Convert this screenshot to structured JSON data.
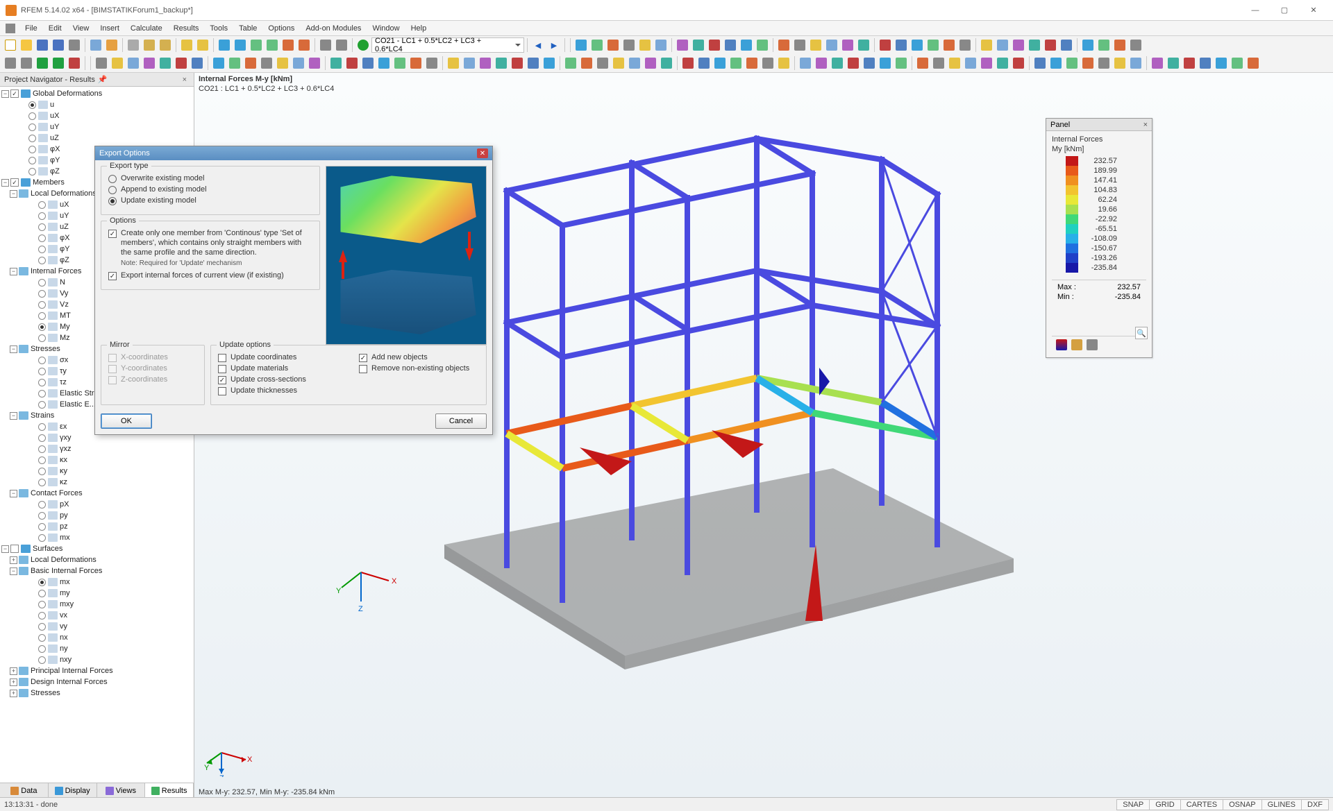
{
  "app": {
    "title": "RFEM 5.14.02 x64 - [BIMSTATIKForum1_backup*]"
  },
  "menu": [
    "File",
    "Edit",
    "View",
    "Insert",
    "Calculate",
    "Results",
    "Tools",
    "Table",
    "Options",
    "Add-on Modules",
    "Window",
    "Help"
  ],
  "combo_dropdown": "CO21 - LC1 + 0.5*LC2 + LC3 + 0.6*LC4",
  "navigator": {
    "title": "Project Navigator - Results",
    "tabs": [
      "Data",
      "Display",
      "Views",
      "Results"
    ],
    "tree": {
      "global_def": {
        "label": "Global Deformations",
        "items": [
          "u",
          "uX",
          "uY",
          "uZ",
          "φX",
          "φY",
          "φZ"
        ]
      },
      "members": {
        "label": "Members",
        "local_def": {
          "label": "Local Deformations",
          "items": [
            "uX",
            "uY",
            "uZ",
            "φX",
            "φY",
            "φZ"
          ]
        },
        "internal_forces": {
          "label": "Internal Forces",
          "items": [
            "N",
            "Vy",
            "Vz",
            "MT",
            "My",
            "Mz"
          ]
        },
        "stresses": {
          "label": "Stresses",
          "items": [
            "σx",
            "τy",
            "τz",
            "Elastic Stress...",
            "Elastic E..."
          ]
        },
        "strains": {
          "label": "Strains",
          "items": [
            "εx",
            "γxy",
            "γxz",
            "κx",
            "κy",
            "κz"
          ]
        },
        "contact": {
          "label": "Contact Forces",
          "items": [
            "pX",
            "py",
            "pz",
            "mx"
          ]
        }
      },
      "surfaces": {
        "label": "Surfaces",
        "local_def": {
          "label": "Local Deformations"
        },
        "basic_if": {
          "label": "Basic Internal Forces",
          "items": [
            "mx",
            "my",
            "mxy",
            "vx",
            "vy",
            "nx",
            "ny",
            "nxy"
          ]
        },
        "principal_if": {
          "label": "Principal Internal Forces"
        },
        "design_if": {
          "label": "Design Internal Forces"
        },
        "stresses2": {
          "label": "Stresses"
        }
      }
    }
  },
  "viewport": {
    "header1": "Internal Forces M-y [kNm]",
    "header2": "CO21 : LC1 + 0.5*LC2 + LC3 + 0.6*LC4",
    "footer": "Max M-y: 232.57, Min M-y: -235.84 kNm"
  },
  "panel": {
    "title": "Panel",
    "sub1": "Internal Forces",
    "sub2": "My  [kNm]",
    "legend": [
      {
        "c": "#c31818",
        "v": "232.57"
      },
      {
        "c": "#e85a1a",
        "v": "189.99"
      },
      {
        "c": "#f09020",
        "v": "147.41"
      },
      {
        "c": "#f2c430",
        "v": "104.83"
      },
      {
        "c": "#e8e838",
        "v": "62.24"
      },
      {
        "c": "#a8e050",
        "v": "19.66"
      },
      {
        "c": "#40d878",
        "v": "-22.92"
      },
      {
        "c": "#20d0c0",
        "v": "-65.51"
      },
      {
        "c": "#28b0e8",
        "v": "-108.09"
      },
      {
        "c": "#2070e0",
        "v": "-150.67"
      },
      {
        "c": "#2040c8",
        "v": "-193.26"
      },
      {
        "c": "#1818a8",
        "v": "-235.84"
      }
    ],
    "max_label": "Max  :",
    "max": "232.57",
    "min_label": "Min   :",
    "min": "-235.84"
  },
  "dialog": {
    "title": "Export Options",
    "export_type": {
      "label": "Export type",
      "overwrite": "Overwrite existing model",
      "append": "Append to existing model",
      "update": "Update existing model"
    },
    "options": {
      "label": "Options",
      "continous": "Create only one member from 'Continous' type 'Set of members', which contains only straight members with the same profile and the same direction.",
      "note": "Note: Required for 'Update' mechanism",
      "export_if": "Export internal forces of current view (if existing)"
    },
    "mirror": {
      "label": "Mirror",
      "x": "X-coordinates",
      "y": "Y-coordinates",
      "z": "Z-coordinates"
    },
    "update": {
      "label": "Update options",
      "coords": "Update coordinates",
      "materials": "Update materials",
      "cross": "Update cross-sections",
      "thick": "Update thicknesses",
      "addnew": "Add new objects",
      "remove": "Remove non-existing objects"
    },
    "ok": "OK",
    "cancel": "Cancel"
  },
  "statusbar": {
    "left": "13:13:31 - done",
    "cells": [
      "SNAP",
      "GRID",
      "CARTES",
      "OSNAP",
      "GLINES",
      "DXF"
    ]
  }
}
